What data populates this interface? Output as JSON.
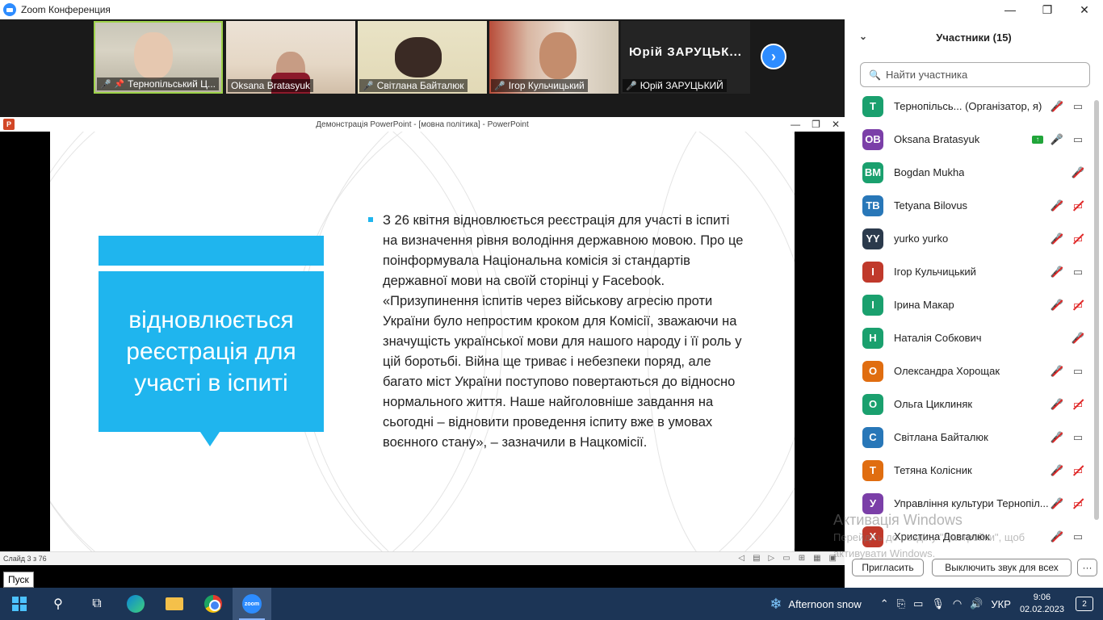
{
  "window": {
    "title": "Zoom Конференция"
  },
  "video_strip": {
    "tiles": [
      {
        "name": "Тернопільський Ц...",
        "muted": true,
        "pinned": true
      },
      {
        "name": "Oksana Bratasyuk",
        "muted": false
      },
      {
        "name": "Світлана Байталюк",
        "muted": true
      },
      {
        "name": "Ігор Кульчицький",
        "muted": true
      },
      {
        "name": "Юрій ЗАРУЦЬКИЙ",
        "big_name": "Юрій ЗАРУЦЬК...",
        "muted": true
      }
    ]
  },
  "ppt": {
    "window_title": "Демонстрація PowerPoint - [мовна політика] - PowerPoint",
    "status": "Слайд 3 з 76",
    "slide": {
      "callout": "відновлюється реєстрація для участі в іспиті",
      "bullet": "З 26 квітня відновлюється реєстрація для участі в іспиті на визначення рівня володіння державною мовою. Про це поінформувала Національна комісія зі стандартів державної мови на своїй сторінці у Facebook. «Призупинення іспитів через військову агресію проти України було непростим кроком для Комісії, зважаючи на значущість української мови для нашого народу і її роль у цій боротьбі. Війна ще триває і небезпеки поряд, але багато міст України поступово повертаються до відносно нормального життя. Наше найголовніше завдання на сьогодні – відновити проведення іспиту вже в умовах воєнного стану», – зазначили в Нацкомісії."
    }
  },
  "start_tooltip": "Пуск",
  "participants": {
    "title": "Участники (15)",
    "search_placeholder": "Найти участника",
    "list": [
      {
        "initials": "Т",
        "name": "Тернопільсь...  (Організатор, я)",
        "color": "#1aa06e",
        "mic": "off",
        "video": "on"
      },
      {
        "initials": "OB",
        "name": "Oksana Bratasyuk",
        "color": "#7b3fa8",
        "mic": "on",
        "video": "on",
        "sharing": true
      },
      {
        "initials": "BM",
        "name": "Bogdan Mukha",
        "color": "#1aa06e",
        "mic": "off",
        "video": "none"
      },
      {
        "initials": "TB",
        "name": "Tetyana Bilovus",
        "color": "#2877b8",
        "mic": "off",
        "video": "off"
      },
      {
        "initials": "YY",
        "name": "yurko yurko",
        "color": "#2b3a4c",
        "mic": "off",
        "video": "off"
      },
      {
        "initials": "І",
        "name": "Ігор Кульчицький",
        "color": "#c0392b",
        "mic": "off",
        "video": "on"
      },
      {
        "initials": "І",
        "name": "Ірина Макар",
        "color": "#1aa06e",
        "mic": "off",
        "video": "off"
      },
      {
        "initials": "Н",
        "name": "Наталія Собкович",
        "color": "#1aa06e",
        "mic": "off",
        "video": "none"
      },
      {
        "initials": "О",
        "name": "Олександра Хорощак",
        "color": "#e06d10",
        "mic": "off",
        "video": "on"
      },
      {
        "initials": "О",
        "name": "Ольга Циклиняк",
        "color": "#1aa06e",
        "mic": "off",
        "video": "off"
      },
      {
        "initials": "С",
        "name": "Світлана Байталюк",
        "color": "#2877b8",
        "mic": "off",
        "video": "on"
      },
      {
        "initials": "Т",
        "name": "Тетяна Колісник",
        "color": "#e06d10",
        "mic": "off",
        "video": "off"
      },
      {
        "initials": "У",
        "name": "Управління культури Тернопіл...",
        "color": "#7b3fa8",
        "mic": "off",
        "video": "off"
      },
      {
        "initials": "Х",
        "name": "Христина Довгалюк",
        "color": "#c0392b",
        "mic": "off",
        "video": "on"
      }
    ],
    "invite_label": "Пригласить",
    "mute_all_label": "Выключить звук для всех",
    "more_label": "···"
  },
  "watermark": {
    "line1": "Активація Windows",
    "line2": "Перейдіть до розділу \"Настройки\", щоб",
    "line3": "активувати Windows."
  },
  "taskbar": {
    "weather": "Afternoon snow",
    "lang": "УКР",
    "time": "9:06",
    "date": "02.02.2023",
    "notifications": "2"
  }
}
